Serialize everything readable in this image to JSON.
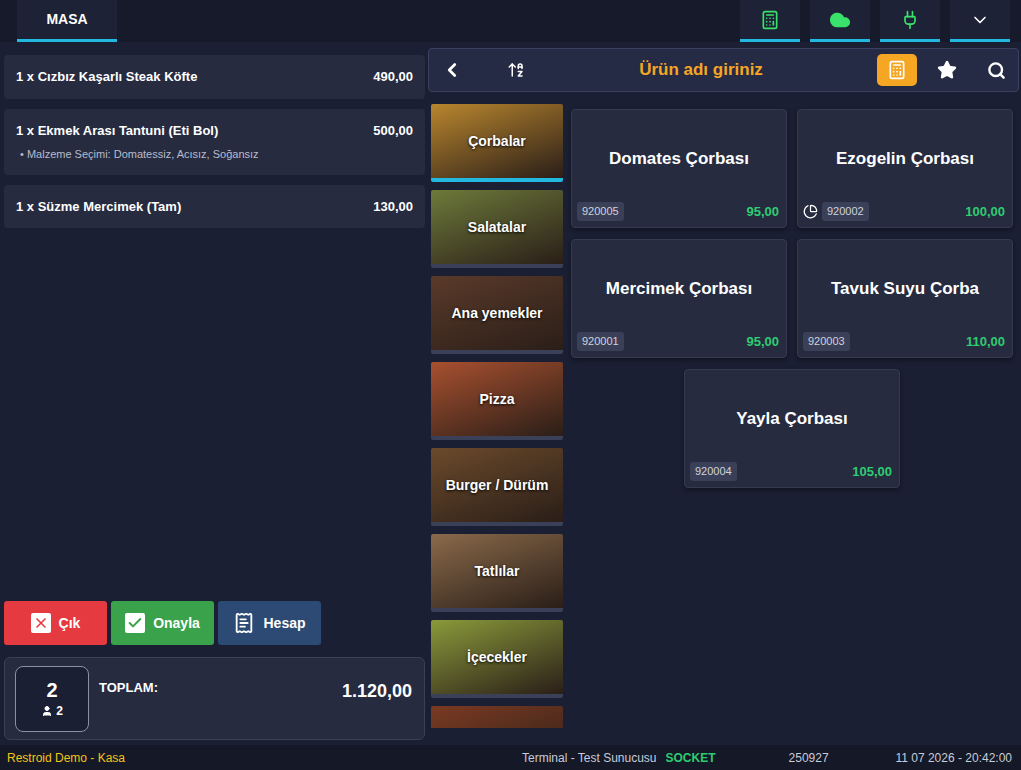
{
  "top_bar": {
    "tab": "MASA"
  },
  "order": {
    "items": [
      {
        "quantity": "1 x",
        "name": "Cızbız Kaşarlı Steak Köfte",
        "price": "490,00",
        "options": []
      },
      {
        "quantity": "1 x",
        "name": "Ekmek Arası Tantuni (Eti Bol)",
        "price": "500,00",
        "options": [
          "• Malzeme Seçimi: Domatessiz, Acısız, Soğansız"
        ]
      },
      {
        "quantity": "1 x",
        "name": "Süzme Mercimek (Tam)",
        "price": "130,00",
        "options": []
      }
    ]
  },
  "actions": [
    {
      "label": "Çık",
      "kind": "cancel",
      "color": "#e53a3f"
    },
    {
      "label": "Onayla",
      "kind": "confirm",
      "color": "#3aa24a"
    },
    {
      "label": "Hesap",
      "kind": "bill",
      "color": "#2c4a73"
    }
  ],
  "total": {
    "table": "2",
    "guests": "2",
    "label": "TOPLAM:",
    "amount": "1.120,00"
  },
  "search": {
    "placeholder": "Ürün adı giriniz"
  },
  "categories": [
    {
      "label": "Çorbalar",
      "selected": true,
      "color": "#b9862e"
    },
    {
      "label": "Salatalar",
      "selected": false,
      "color": "#6d7a3a"
    },
    {
      "label": "Ana yemekler",
      "selected": false,
      "color": "#5a3a2a"
    },
    {
      "label": "Pizza",
      "selected": false,
      "color": "#a8502f"
    },
    {
      "label": "Burger / Dürüm",
      "selected": false,
      "color": "#6b4a2b"
    },
    {
      "label": "Tatlılar",
      "selected": false,
      "color": "#8a6a4a"
    },
    {
      "label": "İçecekler",
      "selected": false,
      "color": "#8a9a3a"
    },
    {
      "label": "",
      "selected": false,
      "color": "#7a3a22"
    }
  ],
  "products": [
    {
      "name": "Domates Çorbası",
      "code": "920005",
      "price": "95,00",
      "portion_icon": false
    },
    {
      "name": "Ezogelin Çorbası",
      "code": "920002",
      "price": "100,00",
      "portion_icon": true
    },
    {
      "name": "Mercimek Çorbası",
      "code": "920001",
      "price": "95,00",
      "portion_icon": false
    },
    {
      "name": "Tavuk Suyu Çorba",
      "code": "920003",
      "price": "110,00",
      "portion_icon": false
    },
    {
      "name": "Yayla Çorbası",
      "code": "920004",
      "price": "105,00",
      "portion_icon": false
    }
  ],
  "status_bar": {
    "app": "Restroid Demo - Kasa",
    "terminal": "Terminal - Test Sunucusu",
    "connection": "SOCKET",
    "id": "250927",
    "datetime": "11 07 2026 - 20:42:00"
  }
}
